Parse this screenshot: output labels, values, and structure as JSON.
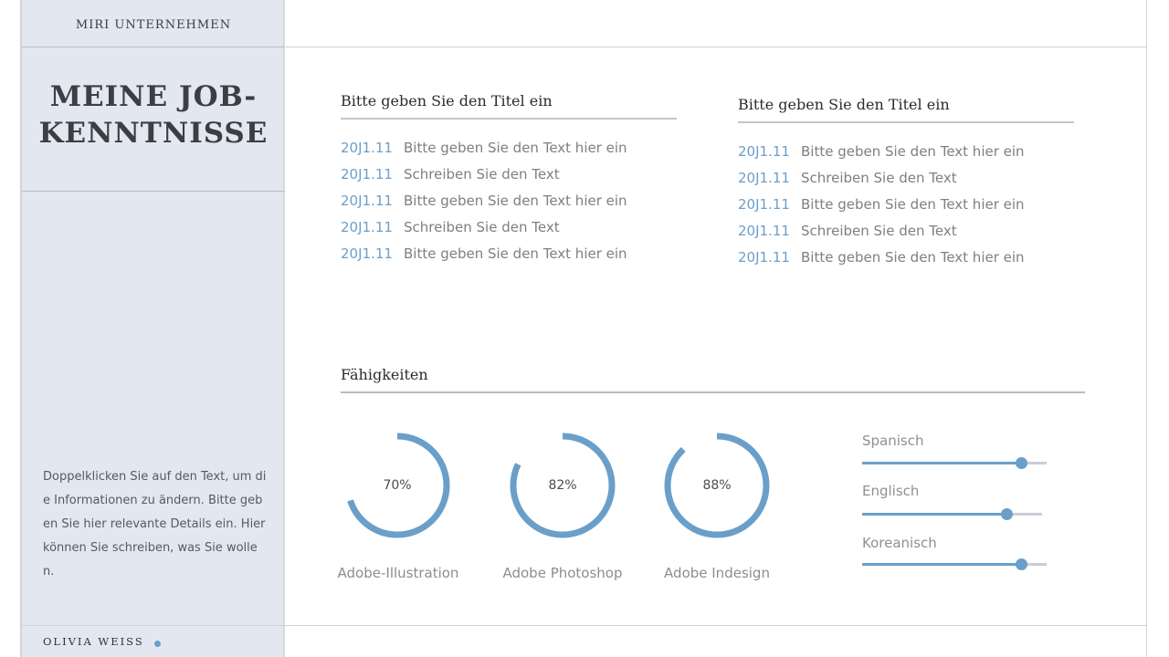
{
  "sidebar": {
    "company": "MIRI UNTERNEHMEN",
    "title_line1": "MEINE JOB-",
    "title_line2": "KENNTNISSE",
    "description": "Doppelklicken Sie auf den Text, um die Informationen zu ändern. Bitte geben Sie hier relevante Details ein. Hier können Sie schreiben, was Sie wollen.",
    "name": "OLIVIA WEISS"
  },
  "columns": [
    {
      "title": "Bitte geben Sie den Titel ein",
      "entries": [
        {
          "year": "20J1.11",
          "text": "Bitte geben Sie den Text hier ein"
        },
        {
          "year": "20J1.11",
          "text": "Schreiben Sie den Text"
        },
        {
          "year": "20J1.11",
          "text": "Bitte geben Sie den Text hier ein"
        },
        {
          "year": "20J1.11",
          "text": "Schreiben Sie den Text"
        },
        {
          "year": "20J1.11",
          "text": "Bitte geben Sie den Text hier ein"
        }
      ]
    },
    {
      "title": "Bitte geben Sie den Titel ein",
      "entries": [
        {
          "year": "20J1.11",
          "text": "Bitte geben Sie den Text hier ein"
        },
        {
          "year": "20J1.11",
          "text": "Schreiben Sie den Text"
        },
        {
          "year": "20J1.11",
          "text": "Bitte geben Sie den Text hier ein"
        },
        {
          "year": "20J1.11",
          "text": "Schreiben Sie den Text"
        },
        {
          "year": "20J1.11",
          "text": "Bitte geben Sie den Text hier ein"
        }
      ]
    }
  ],
  "skills": {
    "title": "Fähigkeiten",
    "software": [
      {
        "label": "Adobe-Illustration",
        "percent_text": "70%",
        "value": 70
      },
      {
        "label": "Adobe Photoshop",
        "percent_text": "82%",
        "value": 82
      },
      {
        "label": "Adobe Indesign",
        "percent_text": "88%",
        "value": 88
      }
    ],
    "languages": [
      {
        "label": "Spanisch",
        "level": 0.86
      },
      {
        "label": "Englisch",
        "level": 0.8
      },
      {
        "label": "Koreanisch",
        "level": 0.86
      }
    ]
  },
  "colors": {
    "accent": "#6a9fc9",
    "sidebar_bg": "#e3e8f0",
    "track": "#c9ced6"
  }
}
